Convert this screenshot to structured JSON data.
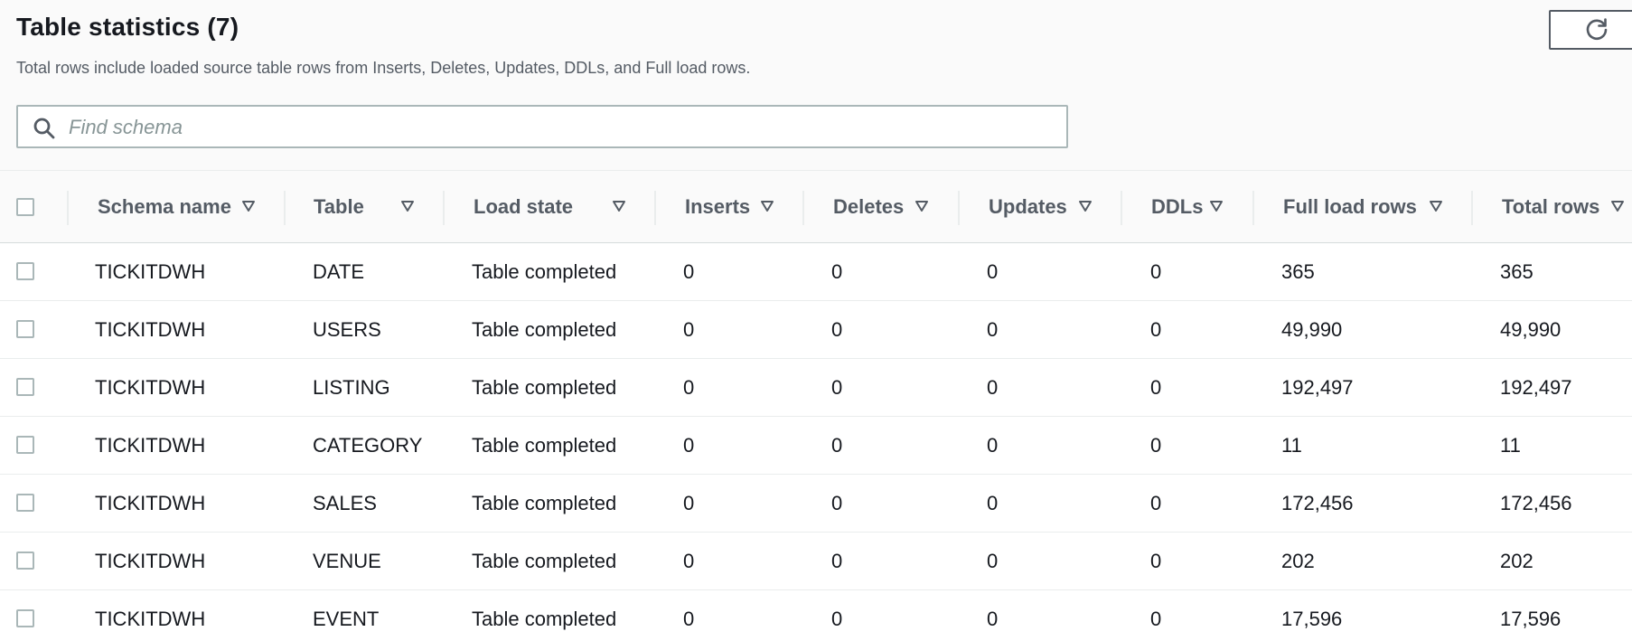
{
  "header": {
    "title": "Table statistics (7)",
    "subtitle": "Total rows include loaded source table rows from Inserts, Deletes, Updates, DDLs, and Full load rows."
  },
  "search": {
    "placeholder": "Find schema",
    "value": ""
  },
  "icons": {
    "refresh": "refresh-icon",
    "search": "search-icon",
    "sort": "caret-down-icon"
  },
  "colors": {
    "text": "#16191f",
    "muted": "#545b64",
    "border": "#aab7b8",
    "placeholder": "#879596"
  },
  "table": {
    "columns": [
      "Schema name",
      "Table",
      "Load state",
      "Inserts",
      "Deletes",
      "Updates",
      "DDLs",
      "Full load rows",
      "Total rows"
    ],
    "rows": [
      [
        "TICKITDWH",
        "DATE",
        "Table completed",
        "0",
        "0",
        "0",
        "0",
        "365",
        "365"
      ],
      [
        "TICKITDWH",
        "USERS",
        "Table completed",
        "0",
        "0",
        "0",
        "0",
        "49,990",
        "49,990"
      ],
      [
        "TICKITDWH",
        "LISTING",
        "Table completed",
        "0",
        "0",
        "0",
        "0",
        "192,497",
        "192,497"
      ],
      [
        "TICKITDWH",
        "CATEGORY",
        "Table completed",
        "0",
        "0",
        "0",
        "0",
        "11",
        "11"
      ],
      [
        "TICKITDWH",
        "SALES",
        "Table completed",
        "0",
        "0",
        "0",
        "0",
        "172,456",
        "172,456"
      ],
      [
        "TICKITDWH",
        "VENUE",
        "Table completed",
        "0",
        "0",
        "0",
        "0",
        "202",
        "202"
      ],
      [
        "TICKITDWH",
        "EVENT",
        "Table completed",
        "0",
        "0",
        "0",
        "0",
        "17,596",
        "17,596"
      ]
    ]
  }
}
